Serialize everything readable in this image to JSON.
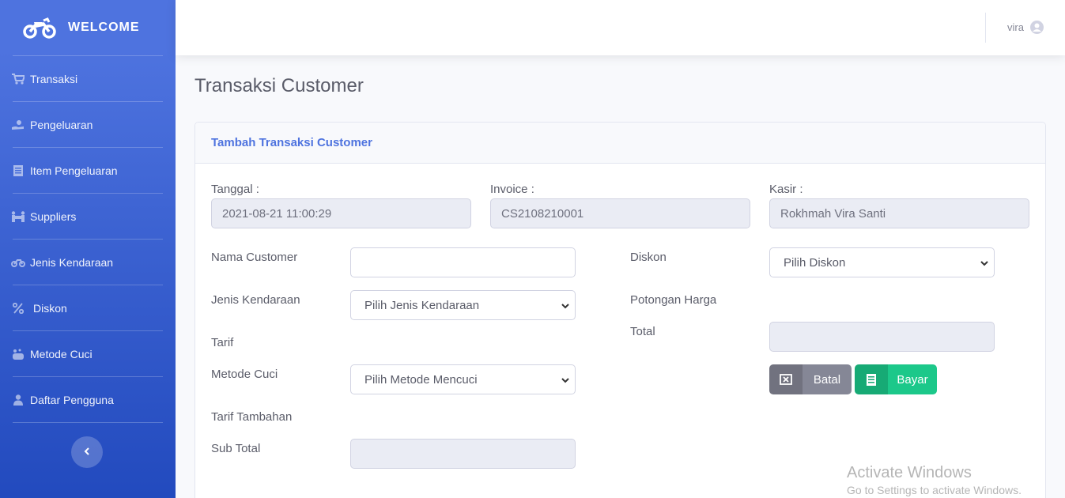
{
  "sidebar": {
    "brand": "WELCOME",
    "items": [
      {
        "label": "Transaksi",
        "icon": "shopping-cart-icon"
      },
      {
        "label": "Pengeluaran",
        "icon": "hand-holding-icon"
      },
      {
        "label": "Item Pengeluaran",
        "icon": "receipt-icon"
      },
      {
        "label": "Suppliers",
        "icon": "people-carry-icon"
      },
      {
        "label": "Jenis Kendaraan",
        "icon": "motorcycle-icon"
      },
      {
        "label": "Diskon",
        "icon": "percent-icon"
      },
      {
        "label": "Metode Cuci",
        "icon": "soap-icon"
      },
      {
        "label": "Daftar Pengguna",
        "icon": "user-icon"
      }
    ]
  },
  "topbar": {
    "user": "vira"
  },
  "page": {
    "title": "Transaksi Customer"
  },
  "card": {
    "title": "Tambah Transaksi Customer",
    "tanggal": {
      "label": "Tanggal :",
      "value": "2021-08-21 11:00:29"
    },
    "invoice": {
      "label": "Invoice :",
      "value": "CS2108210001"
    },
    "kasir": {
      "label": "Kasir :",
      "value": "Rokhmah Vira Santi"
    },
    "nama_customer": {
      "label": "Nama Customer",
      "value": ""
    },
    "jenis_kendaraan": {
      "label": "Jenis Kendaraan",
      "selected": "Pilih Jenis Kendaraan"
    },
    "tarif": {
      "label": "Tarif"
    },
    "metode_cuci": {
      "label": "Metode Cuci",
      "selected": "Pilih Metode Mencuci"
    },
    "tarif_tambahan": {
      "label": "Tarif Tambahan"
    },
    "sub_total": {
      "label": "Sub Total",
      "value": ""
    },
    "diskon": {
      "label": "Diskon",
      "selected": "Pilih Diskon"
    },
    "potongan_harga": {
      "label": "Potongan Harga"
    },
    "total": {
      "label": "Total",
      "value": ""
    },
    "batal_label": "Batal",
    "bayar_label": "Bayar"
  },
  "watermark": {
    "line1": "Activate Windows",
    "line2": "Go to Settings to activate Windows."
  }
}
